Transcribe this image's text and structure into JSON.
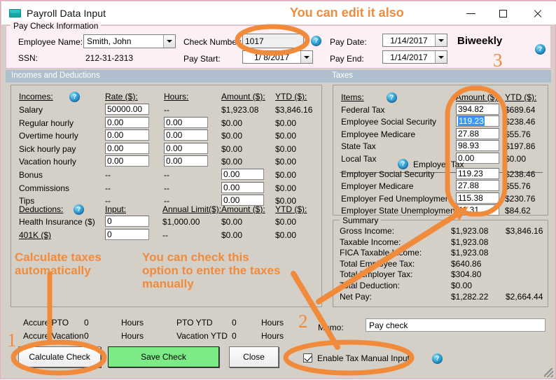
{
  "window": {
    "title": "Payroll Data Input",
    "icon": "window-app-icon",
    "minimize": "—",
    "maximize": "□",
    "close": "×"
  },
  "paycheck_info": {
    "legend": "Pay Check Information",
    "employee_name_label": "Employee Name:",
    "employee_name_value": "Smith, John",
    "ssn_label": "SSN:",
    "ssn_value": "212-31-2313",
    "check_number_label": "Check Number:",
    "check_number_value": "1017",
    "pay_start_label": "Pay Start:",
    "pay_start_value": "1/ 8/2017",
    "pay_date_label": "Pay Date:",
    "pay_date_value": "1/14/2017",
    "pay_end_label": "Pay End:",
    "pay_end_value": "1/14/2017",
    "frequency": "Biweekly",
    "help": "?"
  },
  "incomes_section": {
    "band_caption": "Incomes and Deductions",
    "incomes_header": "Incomes:",
    "columns": [
      "Rate ($):",
      "Hours:",
      "Amount ($):",
      "YTD ($):"
    ],
    "rows": [
      {
        "label": "Salary",
        "rate": "50000.00",
        "rate_input": true,
        "hours": "--",
        "hours_input": false,
        "amount": "$1,923.08",
        "amount_input": false,
        "ytd": "$3,846.16"
      },
      {
        "label": "Regular hourly",
        "rate": "0.00",
        "rate_input": true,
        "hours": "0.00",
        "hours_input": true,
        "amount": "$0.00",
        "amount_input": false,
        "ytd": "$0.00"
      },
      {
        "label": "Overtime hourly",
        "rate": "0.00",
        "rate_input": true,
        "hours": "0.00",
        "hours_input": true,
        "amount": "$0.00",
        "amount_input": false,
        "ytd": "$0.00"
      },
      {
        "label": "Sick hourly pay",
        "rate": "0.00",
        "rate_input": true,
        "hours": "0.00",
        "hours_input": true,
        "amount": "$0.00",
        "amount_input": false,
        "ytd": "$0.00"
      },
      {
        "label": "Vacation hourly",
        "rate": "0.00",
        "rate_input": true,
        "hours": "0.00",
        "hours_input": true,
        "amount": "$0.00",
        "amount_input": false,
        "ytd": "$0.00"
      },
      {
        "label": "Bonus",
        "rate": "--",
        "rate_input": false,
        "hours": "--",
        "hours_input": false,
        "amount": "0.00",
        "amount_input": true,
        "ytd": "$0.00"
      },
      {
        "label": "Commissions",
        "rate": "--",
        "rate_input": false,
        "hours": "--",
        "hours_input": false,
        "amount": "0.00",
        "amount_input": true,
        "ytd": "$0.00"
      },
      {
        "label": "Tips",
        "rate": "--",
        "rate_input": false,
        "hours": "--",
        "hours_input": false,
        "amount": "0.00",
        "amount_input": true,
        "ytd": "$0.00"
      }
    ],
    "deductions_header": "Deductions:",
    "deduction_columns": [
      "Input:",
      "Annual Limit($):",
      "Amount ($):",
      "YTD ($):"
    ],
    "deduction_rows": [
      {
        "label": "Health Insurance  ($)",
        "input": "0",
        "limit": "$1,000.00",
        "amount": "$0.00",
        "ytd": "$0.00"
      },
      {
        "label": "401K  ($)",
        "input": "0",
        "limit": "--",
        "amount": "$0.00",
        "ytd": "$0.00"
      }
    ]
  },
  "taxes_section": {
    "band_caption": "Taxes",
    "items_header": "Items:",
    "columns": [
      "Amount ($):",
      "YTD ($):"
    ],
    "employee_rows": [
      {
        "label": "Federal Tax",
        "amount": "394.82",
        "ytd": "$689.64",
        "selected": false
      },
      {
        "label": "Employee Social Security",
        "amount": "119.23",
        "ytd": "$238.46",
        "selected": true
      },
      {
        "label": "Employee Medicare",
        "amount": "27.88",
        "ytd": "$55.76",
        "selected": false
      },
      {
        "label": "State Tax",
        "amount": "98.93",
        "ytd": "$197.86",
        "selected": false
      },
      {
        "label": "Local Tax",
        "amount": "0.00",
        "ytd": "$0.00",
        "selected": false
      }
    ],
    "employer_header": "Employer Tax",
    "employer_rows": [
      {
        "label": "Employer Social Security",
        "amount": "119.23",
        "ytd": "$238.46"
      },
      {
        "label": "Employer Medicare",
        "amount": "27.88",
        "ytd": "$55.76"
      },
      {
        "label": "Employer Fed Unemployment",
        "amount": "115.38",
        "ytd": "$230.76"
      },
      {
        "label": "Employer State Unemployment",
        "amount": "42.31",
        "ytd": "$84.62"
      }
    ]
  },
  "summary": {
    "legend": "Summary",
    "rows": [
      {
        "label": "Gross Income:",
        "amount": "$1,923.08",
        "ytd": "$3,846.16"
      },
      {
        "label": "Taxable Income:",
        "amount": "$1,923.08",
        "ytd": ""
      },
      {
        "label": "FICA Taxable Income:",
        "amount": "$1,923.08",
        "ytd": ""
      },
      {
        "label": "Total Employee Tax:",
        "amount": "$640.86",
        "ytd": ""
      },
      {
        "label": "Total Employer Tax:",
        "amount": "$304.80",
        "ytd": ""
      },
      {
        "label": "Total Deduction:",
        "amount": "$0.00",
        "ytd": ""
      },
      {
        "label": "Net Pay:",
        "amount": "$1,282.22",
        "ytd": "$2,664.44"
      }
    ]
  },
  "accruals": {
    "rows": [
      {
        "label": "Accure PTO",
        "value": "0",
        "unit": "Hours",
        "ytd_label": "PTO YTD",
        "ytd_value": "0",
        "ytd_unit": "Hours"
      },
      {
        "label": "Accure Vacation",
        "value": "0",
        "unit": "Hours",
        "ytd_label": "Vacation YTD",
        "ytd_value": "0",
        "ytd_unit": "Hours"
      }
    ]
  },
  "footer": {
    "calculate_check": "Calculate Check",
    "save_check": "Save Check",
    "close": "Close",
    "memo_label": "Memo:",
    "memo_value": "Pay check",
    "enable_manual": "Enable Tax Manual Input",
    "enable_manual_checked": true,
    "help": "?"
  },
  "annotations": {
    "edit_also": "You can edit it also",
    "calc_auto": "Calculate taxes\nautomatically",
    "check_option": "You can check this\noption to enter the taxes\nmanually",
    "num1": "1",
    "num2": "2",
    "num3": "3",
    "color": "#f08b3c"
  }
}
